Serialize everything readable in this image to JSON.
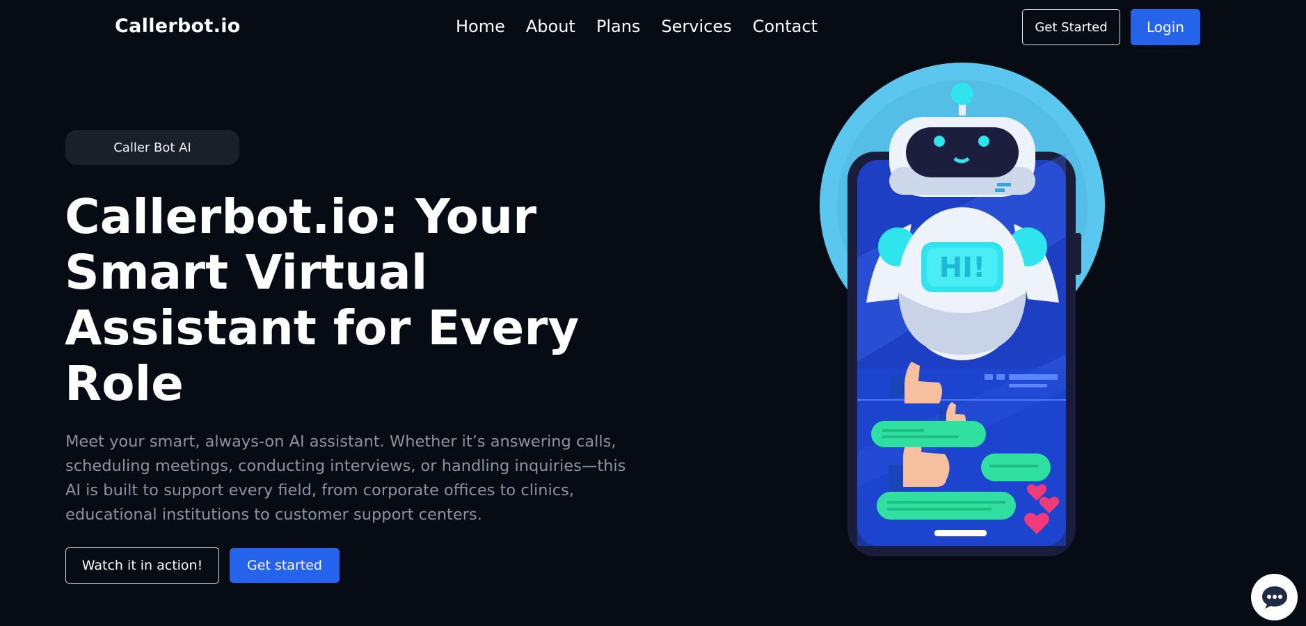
{
  "header": {
    "brand": "Callerbot.io",
    "nav": [
      "Home",
      "About",
      "Plans",
      "Services",
      "Contact"
    ],
    "get_started_label": "Get Started",
    "login_label": "Login"
  },
  "hero": {
    "badge": "Caller Bot AI",
    "title": "Callerbot.io: Your Smart Virtual Assistant for Every Role",
    "subtitle": "Meet your smart, always-on AI assistant. Whether it’s answering calls, scheduling meetings, conducting interviews, or handling inquiries—this AI is built to support every field, from corporate offices to clinics, educational institutions to customer support centers.",
    "watch_label": "Watch it in action!",
    "get_started_label": "Get started",
    "illustration_text": "HI!"
  },
  "chat_widget": {
    "icon": "chat-bubble-icon"
  },
  "colors": {
    "background": "#070b14",
    "accent": "#2563eb",
    "subtitle_text": "#8b93a3",
    "badge_bg": "#1a1f29"
  }
}
